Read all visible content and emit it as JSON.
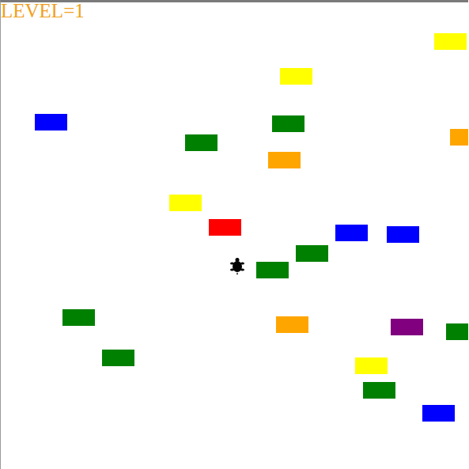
{
  "level_label": "LEVEL=1",
  "blocks": [
    {
      "color": "#ffff00"
    },
    {
      "color": "#ffff00"
    },
    {
      "color": "#0000ff"
    },
    {
      "color": "#008000"
    },
    {
      "color": "#008000"
    },
    {
      "color": "#ffa500"
    },
    {
      "color": "#ffa500"
    },
    {
      "color": "#ffff00"
    },
    {
      "color": "#ff0000"
    },
    {
      "color": "#0000ff"
    },
    {
      "color": "#0000ff"
    },
    {
      "color": "#008000"
    },
    {
      "color": "#008000"
    },
    {
      "color": "#008000"
    },
    {
      "color": "#ffa500"
    },
    {
      "color": "#800080"
    },
    {
      "color": "#008000"
    },
    {
      "color": "#008000"
    },
    {
      "color": "#ffff00"
    },
    {
      "color": "#008000"
    },
    {
      "color": "#0000ff"
    }
  ]
}
